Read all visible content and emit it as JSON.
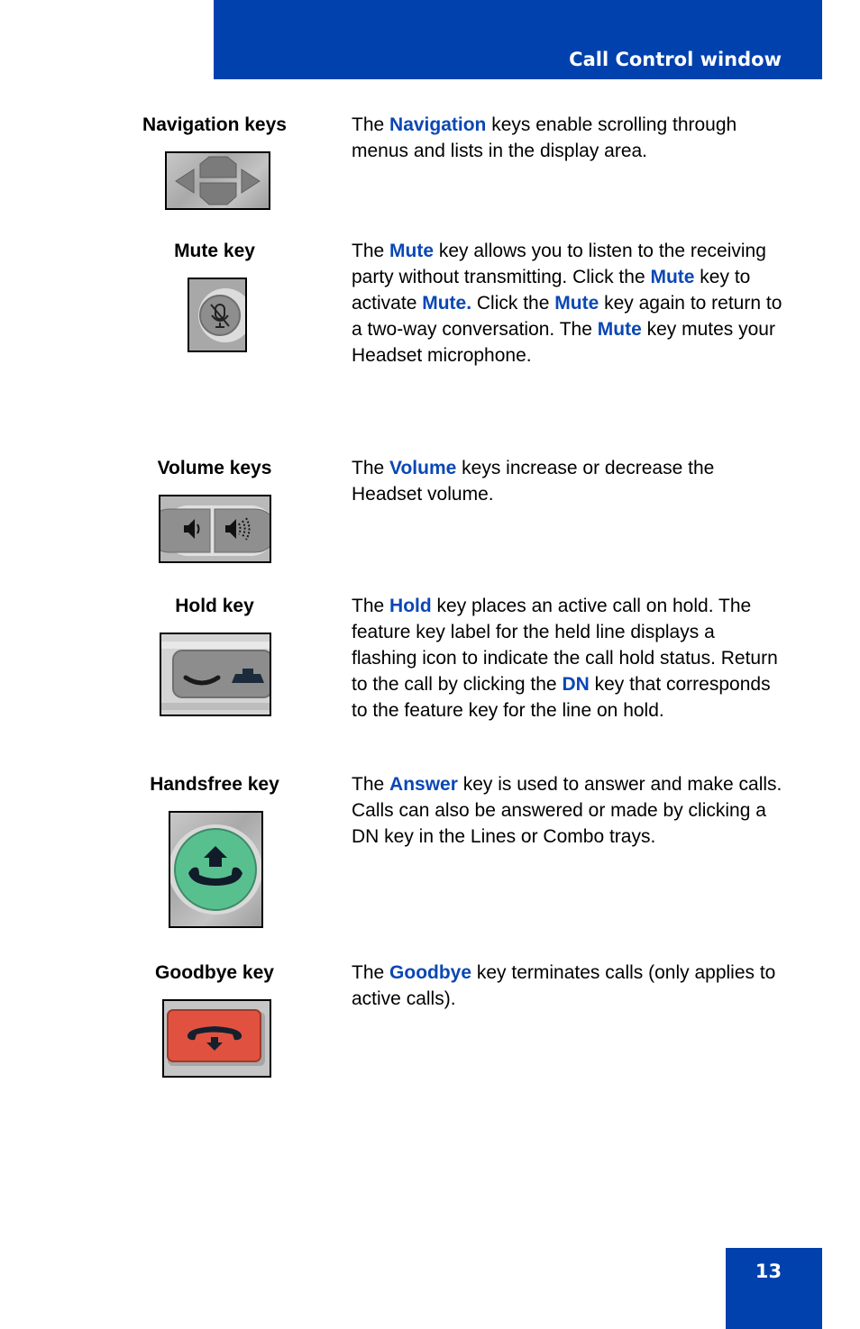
{
  "header": {
    "title": "Call Control window"
  },
  "page_number": "13",
  "colors": {
    "brand_blue": "#0041ad",
    "keyword_blue": "#0a47b4",
    "answer_green": "#58c08e",
    "goodbye_red": "#e0523f"
  },
  "entries": [
    {
      "label": "Navigation keys",
      "icon": "navigation-keys-icon",
      "desc": [
        {
          "t": "The "
        },
        {
          "t": "Navigation",
          "k": true
        },
        {
          "t": " keys enable scrolling through menus and lists in the display area."
        }
      ]
    },
    {
      "label": "Mute key",
      "icon": "mute-microphone-icon",
      "desc": [
        {
          "t": "The "
        },
        {
          "t": "Mute",
          "k": true
        },
        {
          "t": " key allows you to listen to the receiving party without transmitting. Click the "
        },
        {
          "t": "Mute",
          "k": true
        },
        {
          "t": " key to activate "
        },
        {
          "t": "Mute.",
          "k": true
        },
        {
          "t": " Click the "
        },
        {
          "t": "Mute",
          "k": true
        },
        {
          "t": " key again to return to a two-way conversation. The "
        },
        {
          "t": "Mute",
          "k": true
        },
        {
          "t": " key mutes your Headset microphone."
        }
      ]
    },
    {
      "label": "Volume keys",
      "icon": "volume-speaker-icon",
      "desc": [
        {
          "t": "The "
        },
        {
          "t": "Volume",
          "k": true
        },
        {
          "t": " keys increase or decrease the Headset volume."
        }
      ]
    },
    {
      "label": "Hold key",
      "icon": "hold-handset-icon",
      "desc": [
        {
          "t": "The "
        },
        {
          "t": "Hold",
          "k": true
        },
        {
          "t": " key places an active call on hold. The feature key label for the held line displays a flashing icon to indicate the call hold status. Return to the call by clicking the "
        },
        {
          "t": "DN",
          "k": true
        },
        {
          "t": " key that corresponds to the feature key for the line on hold."
        }
      ]
    },
    {
      "label": "Handsfree key",
      "icon": "answer-handset-icon",
      "desc": [
        {
          "t": "The "
        },
        {
          "t": "Answer",
          "k": true
        },
        {
          "t": " key is used to answer and make calls. Calls can also be answered or made by clicking a DN key in the Lines or Combo trays."
        }
      ]
    },
    {
      "label": "Goodbye key",
      "icon": "goodbye-handset-icon",
      "desc": [
        {
          "t": "The "
        },
        {
          "t": "Goodbye",
          "k": true
        },
        {
          "t": " key terminates calls (only applies to active calls)."
        }
      ]
    }
  ]
}
